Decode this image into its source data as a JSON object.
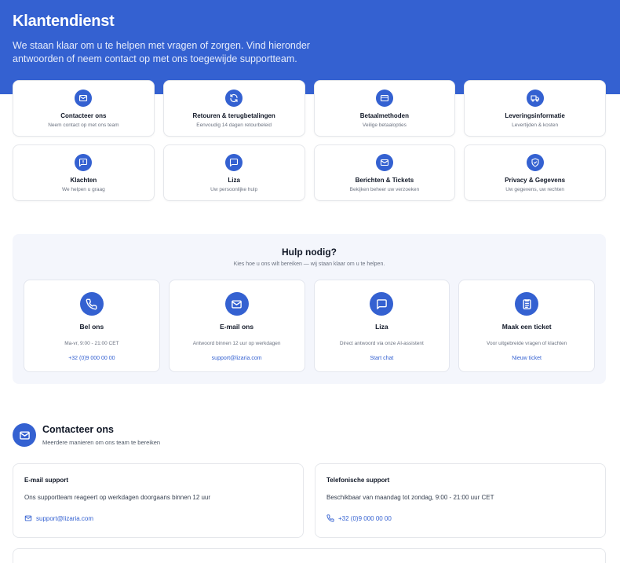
{
  "hero": {
    "title": "Klantendienst",
    "intro": "We staan klaar om u te helpen met vragen of zorgen. Vind hieronder antwoorden of neem contact op met ons toegewijde supportteam."
  },
  "topics": [
    {
      "icon": "mail-icon",
      "title": "Contacteer ons",
      "subtitle": "Neem contact op met ons team"
    },
    {
      "icon": "refresh-icon",
      "title": "Retouren & terugbetalingen",
      "subtitle": "Eenvoudig 14 dagen retourbeleid"
    },
    {
      "icon": "credit-card-icon",
      "title": "Betaalmethoden",
      "subtitle": "Veilige betaalopties"
    },
    {
      "icon": "truck-icon",
      "title": "Leveringsinformatie",
      "subtitle": "Levertijden & kosten"
    },
    {
      "icon": "chat-alert-icon",
      "title": "Klachten",
      "subtitle": "We helpen u graag"
    },
    {
      "icon": "chat-icon",
      "title": "Liza",
      "subtitle": "Uw persoonlijke hulp"
    },
    {
      "icon": "mail-icon",
      "title": "Berichten & Tickets",
      "subtitle": "Bekijken beheer uw verzoeken"
    },
    {
      "icon": "shield-check-icon",
      "title": "Privacy & Gegevens",
      "subtitle": "Uw gegevens, uw rechten"
    }
  ],
  "help": {
    "title": "Hulp nodig?",
    "subtitle": "Kies hoe u ons wilt bereiken — wij staan klaar om u te helpen.",
    "options": [
      {
        "icon": "phone-icon",
        "title": "Bel ons",
        "desc": "Ma-vr, 9:00 - 21:00 CET",
        "link": "+32 (0)9 000 00 00"
      },
      {
        "icon": "mail-icon",
        "title": "E-mail ons",
        "desc": "Antwoord binnen 12 uur op werkdagen",
        "link": "support@lizaria.com"
      },
      {
        "icon": "chat-icon",
        "title": "Liza",
        "desc": "Direct antwoord via onze AI-assistent",
        "link": "Start chat"
      },
      {
        "icon": "ticket-icon",
        "title": "Maak een ticket",
        "desc": "Voor uitgebreide vragen of klachten",
        "link": "Nieuw ticket"
      }
    ]
  },
  "contact": {
    "title": "Contacteer ons",
    "subtitle": "Meerdere manieren om ons team te bereiken",
    "cards": [
      {
        "title": "E-mail support",
        "desc": "Ons supportteam reageert op werkdagen doorgaans binnen 12 uur",
        "link_icon": "mail-icon",
        "link": "support@lizaria.com"
      },
      {
        "title": "Telefonische support",
        "desc": "Beschikbaar van maandag tot zondag, 9:00 - 21:00 uur CET",
        "link_icon": "phone-icon",
        "link": "+32 (0)9 000 00 00"
      }
    ]
  },
  "colors": {
    "accent": "#3461d1",
    "panel": "#f4f6fc"
  }
}
